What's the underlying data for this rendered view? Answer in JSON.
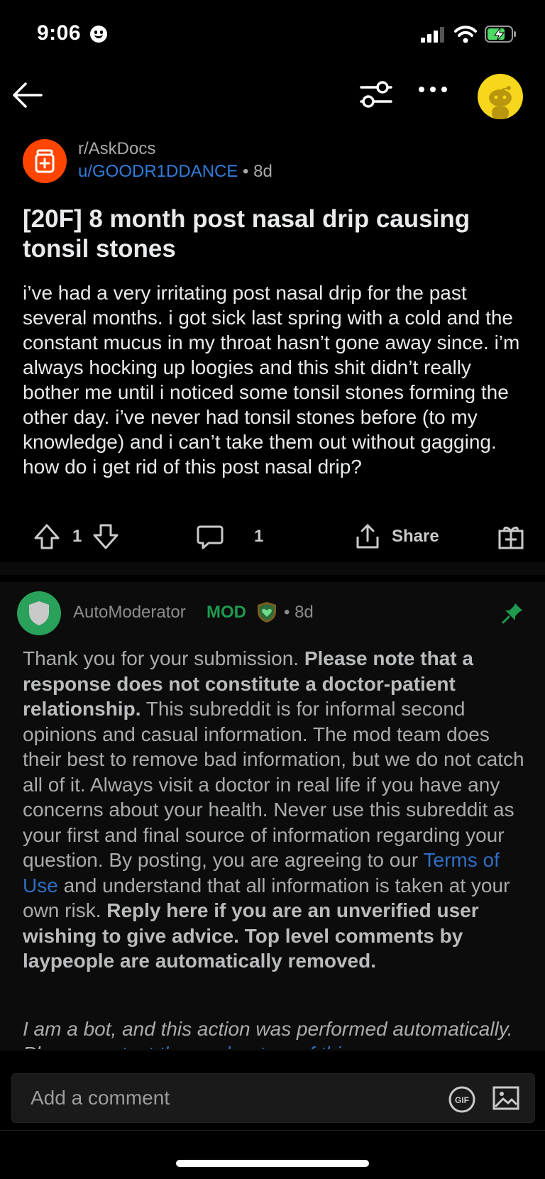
{
  "status": {
    "time": "9:06"
  },
  "subreddit": "r/AskDocs",
  "post": {
    "author": "u/GOODR1DDANCE",
    "age": "• 8d",
    "title": "[20F] 8 month post nasal drip causing tonsil stones",
    "body": "i’ve had a very irritating post nasal drip for the past several months. i got sick last spring with a cold and the constant mucus in my throat hasn’t gone away since. i’m always hocking up loogies and this shit didn’t really bother me until i noticed some tonsil stones forming the other day. i’ve never had tonsil stones before (to my knowledge) and i can’t take them out without gagging. how do i get rid of this post nasal drip?",
    "votes": "1",
    "comments": "1",
    "share_label": "Share"
  },
  "comment": {
    "author": "AutoModerator",
    "badge": "MOD",
    "age": "• 8d",
    "p1": "Thank you for your submission. ",
    "p1_bold": "Please note that a response does not constitute a doctor-patient relationship.",
    "p2": " This subreddit is for informal second opinions and casual information. The mod team does their best to remove bad information, but we do not catch all of it. Always visit a doctor in real life if you have any concerns about your health. Never use this subreddit as your first and final source of information regarding your question. By posting, you are agreeing to our ",
    "link1": "Terms of Use",
    "p3": " and understand that all information is taken at your own risk. ",
    "p3_bold": "Reply here if you are an unverified user wishing to give advice. Top level comments by laypeople are automatically removed.",
    "bot_text": "I am a bot, and this action was performed automatically. Please ",
    "bot_link": "contact the moderators of this"
  },
  "composer": {
    "placeholder": "Add a comment"
  },
  "icons": {
    "back": "back-arrow-icon",
    "filter": "sort-filter-icon",
    "more": "more-icon",
    "upvote": "upvote-icon",
    "downvote": "downvote-icon",
    "comment": "comment-icon",
    "share": "share-icon",
    "award": "award-icon",
    "pin": "pin-icon",
    "gif": "gif-icon",
    "image": "image-icon"
  },
  "colors": {
    "accent_blue": "#2f7ddb",
    "subreddit_orange": "#ff4500",
    "mod_green": "#1e9a4f"
  }
}
